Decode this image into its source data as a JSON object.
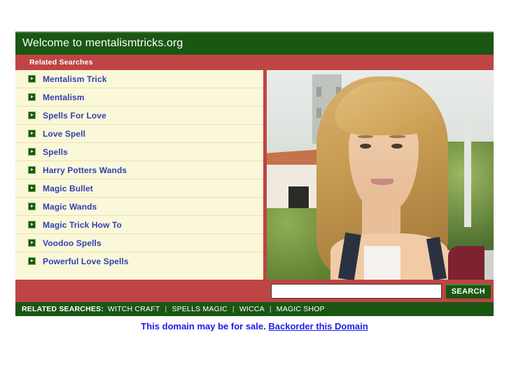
{
  "header": {
    "title": "Welcome to mentalismtricks.org",
    "subhead": "Related Searches"
  },
  "colors": {
    "green": "#1a5713",
    "green_light": "#4c8342",
    "red": "#bf4444",
    "list_bg": "#faf8d8",
    "link_blue": "#3340b5",
    "sale_blue": "#1a1af0"
  },
  "links": [
    {
      "label": "Mentalism Trick"
    },
    {
      "label": "Mentalism"
    },
    {
      "label": "Spells For Love"
    },
    {
      "label": "Love Spell"
    },
    {
      "label": "Spells"
    },
    {
      "label": "Harry Potters Wands"
    },
    {
      "label": "Magic Bullet"
    },
    {
      "label": "Magic Wands"
    },
    {
      "label": "Magic Trick How To"
    },
    {
      "label": "Voodoo Spells"
    },
    {
      "label": "Powerful Love Spells"
    }
  ],
  "photo": {
    "alt": "Smiling blonde woman outdoors wearing a backpack"
  },
  "search": {
    "value": "",
    "placeholder": "",
    "button_label": "SEARCH"
  },
  "footer": {
    "label": "RELATED SEARCHES:",
    "items": [
      "WITCH CRAFT",
      "SPELLS MAGIC",
      "WICCA",
      "MAGIC SHOP"
    ],
    "separator": "|"
  },
  "sale": {
    "text": "This domain may be for sale.",
    "link_label": "Backorder this Domain"
  }
}
